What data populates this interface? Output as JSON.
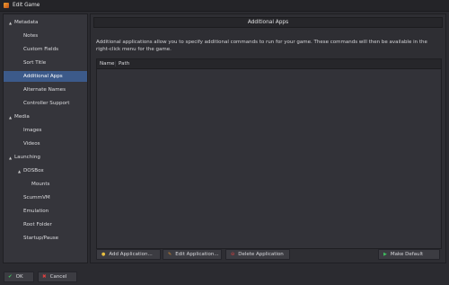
{
  "window": {
    "title": "Edit Game"
  },
  "sidebar": {
    "items": [
      {
        "label": "Metadata",
        "expanded": true
      },
      {
        "label": "Notes"
      },
      {
        "label": "Custom Fields"
      },
      {
        "label": "Sort Title"
      },
      {
        "label": "Additional Apps",
        "selected": true
      },
      {
        "label": "Alternate Names"
      },
      {
        "label": "Controller Support"
      },
      {
        "label": "Media",
        "expanded": true
      },
      {
        "label": "Images"
      },
      {
        "label": "Videos"
      },
      {
        "label": "Launching",
        "expanded": true
      },
      {
        "label": "DOSBox",
        "expanded": true
      },
      {
        "label": "Mounts"
      },
      {
        "label": "ScummVM"
      },
      {
        "label": "Emulation"
      },
      {
        "label": "Root Folder"
      },
      {
        "label": "Startup/Pause"
      }
    ]
  },
  "main": {
    "header": "Additional Apps",
    "description": "Additional applications allow you to specify additional commands to run for your game.  These commands will then be available in the right-click menu for the game.",
    "table": {
      "columns": [
        "Name",
        "Path"
      ],
      "rows": []
    },
    "buttons": {
      "add": "Add Application...",
      "edit": "Edit Application...",
      "delete": "Delete Application",
      "default": "Make Default"
    }
  },
  "footer": {
    "ok": "OK",
    "cancel": "Cancel"
  },
  "colors": {
    "background": "#2b2b30",
    "selection": "#3c5a8a"
  }
}
